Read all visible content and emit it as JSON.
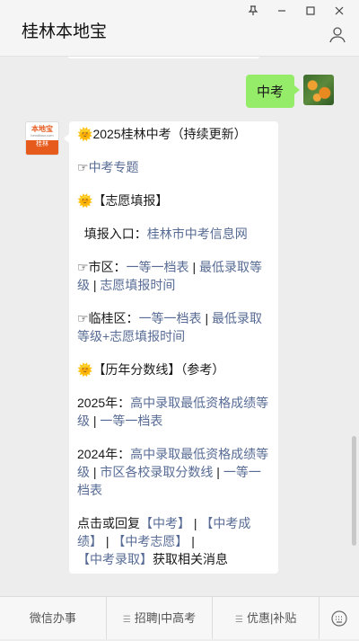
{
  "window": {
    "title": "桂林本地宝",
    "controls": [
      "pin",
      "minimize",
      "maximize",
      "close"
    ]
  },
  "messages": {
    "me": {
      "text": "中考"
    },
    "bot": {
      "avatar": {
        "top": "本地宝",
        "mid": "bendibao.com",
        "bottom": "桂林"
      },
      "header": "2025桂林中考（持续更新）",
      "topic_prefix": "☞",
      "topic_link": "中考专题",
      "section1_title": "【志愿填报】",
      "entry_label": "填报入口：",
      "entry_link": "桂林市中考信息网",
      "city_prefix": "☞市区：",
      "city_link1": "一等一档表",
      "sep": " | ",
      "city_link2": "最低录取等级",
      "city_link3": "志愿填报时间",
      "lingui_prefix": "☞临桂区：",
      "lingui_link1": "一等一档表",
      "lingui_link2": "最低录取等级+志愿填报时间",
      "section2_title": "【历年分数线】（参考）",
      "y2025_label": "2025年：",
      "y2025_link1": "高中录取最低资格成绩等级",
      "y2025_link2": "一等一档表",
      "y2024_label": "2024年：",
      "y2024_link1": "高中录取最低资格成绩等级",
      "y2024_link2": "市区各校录取分数线",
      "y2024_link3": "一等一档表",
      "footer_prefix": "点击或回复",
      "footer_kw1": "【中考】",
      "footer_kw2": "【中考成绩】",
      "footer_kw3": "【中考志愿】",
      "footer_kw4": "【中考录取】",
      "footer_sep": " | ",
      "footer_suffix": "获取相关消息"
    }
  },
  "bottom_menu": {
    "items": [
      "微信办事",
      "招聘|中高考",
      "优惠|补贴"
    ]
  },
  "colors": {
    "link": "#576b95",
    "my_bubble": "#95ec69",
    "accent": "#e65a1c"
  }
}
